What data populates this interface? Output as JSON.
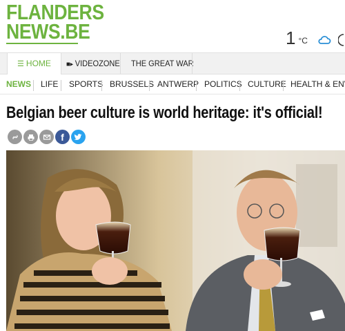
{
  "logo": {
    "line1": "FLANDERS",
    "line2": "NEWS.BE",
    "color": "#6db33f"
  },
  "weather": {
    "temperature": "1",
    "unit": "°C",
    "icon": "cloud-icon"
  },
  "main_nav": [
    {
      "label": "HOME",
      "icon": "list-icon",
      "active": true
    },
    {
      "label": "VIDEOZONE",
      "icon": "video-camera-icon",
      "active": false
    },
    {
      "label": "THE GREAT WAR",
      "active": false
    }
  ],
  "sub_nav": [
    {
      "label": "NEWS",
      "active": true
    },
    {
      "label": "LIFE"
    },
    {
      "label": "SPORTS"
    },
    {
      "label": "BRUSSELS"
    },
    {
      "label": "ANTWERP"
    },
    {
      "label": "POLITICS"
    },
    {
      "label": "CULTURE"
    },
    {
      "label": "HEALTH & ENVIRO"
    }
  ],
  "article": {
    "headline": "Belgian beer culture is world heritage: it's official!"
  },
  "share_buttons": [
    {
      "name": "link-icon",
      "color": "#9a9a9a"
    },
    {
      "name": "print-icon",
      "color": "#9a9a9a"
    },
    {
      "name": "email-icon",
      "color": "#9a9a9a"
    },
    {
      "name": "facebook-icon",
      "color": "#3b5998"
    },
    {
      "name": "twitter-icon",
      "color": "#2aa3ef"
    }
  ]
}
